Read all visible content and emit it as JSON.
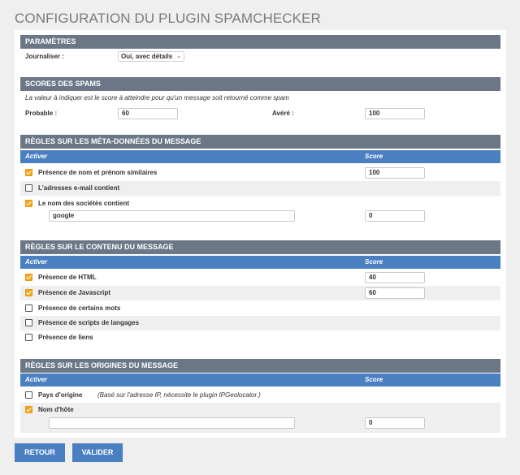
{
  "page_title": "CONFIGURATION DU PLUGIN SPAMCHECKER",
  "columns": {
    "activer": "Activer",
    "score": "Score"
  },
  "parametres": {
    "header": "PARAMÈTRES",
    "journaliser_label": "Journaliser :",
    "journaliser_value": "Oui, avec détails"
  },
  "scores": {
    "header": "SCORES DES SPAMS",
    "description": "La valeur à indiquer est le score à atteindre pour qu'un message soit retourné comme spam",
    "probable_label": "Probable :",
    "probable_value": "60",
    "avere_label": "Avéré :",
    "avere_value": "100"
  },
  "meta": {
    "header": "RÈGLES SUR LES MÉTA-DONNÉES DU MESSAGE",
    "rules": [
      {
        "label": "Présence de nom et prénom similaires",
        "checked": true,
        "score": "100"
      },
      {
        "label": "L'adresses e-mail contient",
        "checked": false
      },
      {
        "label": "Le nom des sociétés contient",
        "checked": true,
        "text": "google",
        "score": "0"
      }
    ]
  },
  "contenu": {
    "header": "RÈGLES SUR LE CONTENU DU MESSAGE",
    "rules": [
      {
        "label": "Présence de HTML",
        "checked": true,
        "score": "40"
      },
      {
        "label": "Présence de Javascript",
        "checked": true,
        "score": "60"
      },
      {
        "label": "Présence de certains mots",
        "checked": false
      },
      {
        "label": "Présence de scripts de langages",
        "checked": false
      },
      {
        "label": "Présence de liens",
        "checked": false
      }
    ]
  },
  "origines": {
    "header": "RÈGLES SUR LES ORIGINES DU MESSAGE",
    "rules": [
      {
        "label": "Pays d'origine",
        "checked": false,
        "note": "(Basé sur l'adresse IP, nécessite le plugin IPGeolocator.)"
      },
      {
        "label": "Nom d'hôte",
        "checked": true,
        "text": "",
        "score": "0"
      }
    ]
  },
  "buttons": {
    "retour": "RETOUR",
    "valider": "VALIDER"
  },
  "colors": {
    "section_header": "#6b7787",
    "column_header": "#4a7fc1",
    "checkbox_on": "#f2a81d",
    "button": "#4a7fc1"
  }
}
